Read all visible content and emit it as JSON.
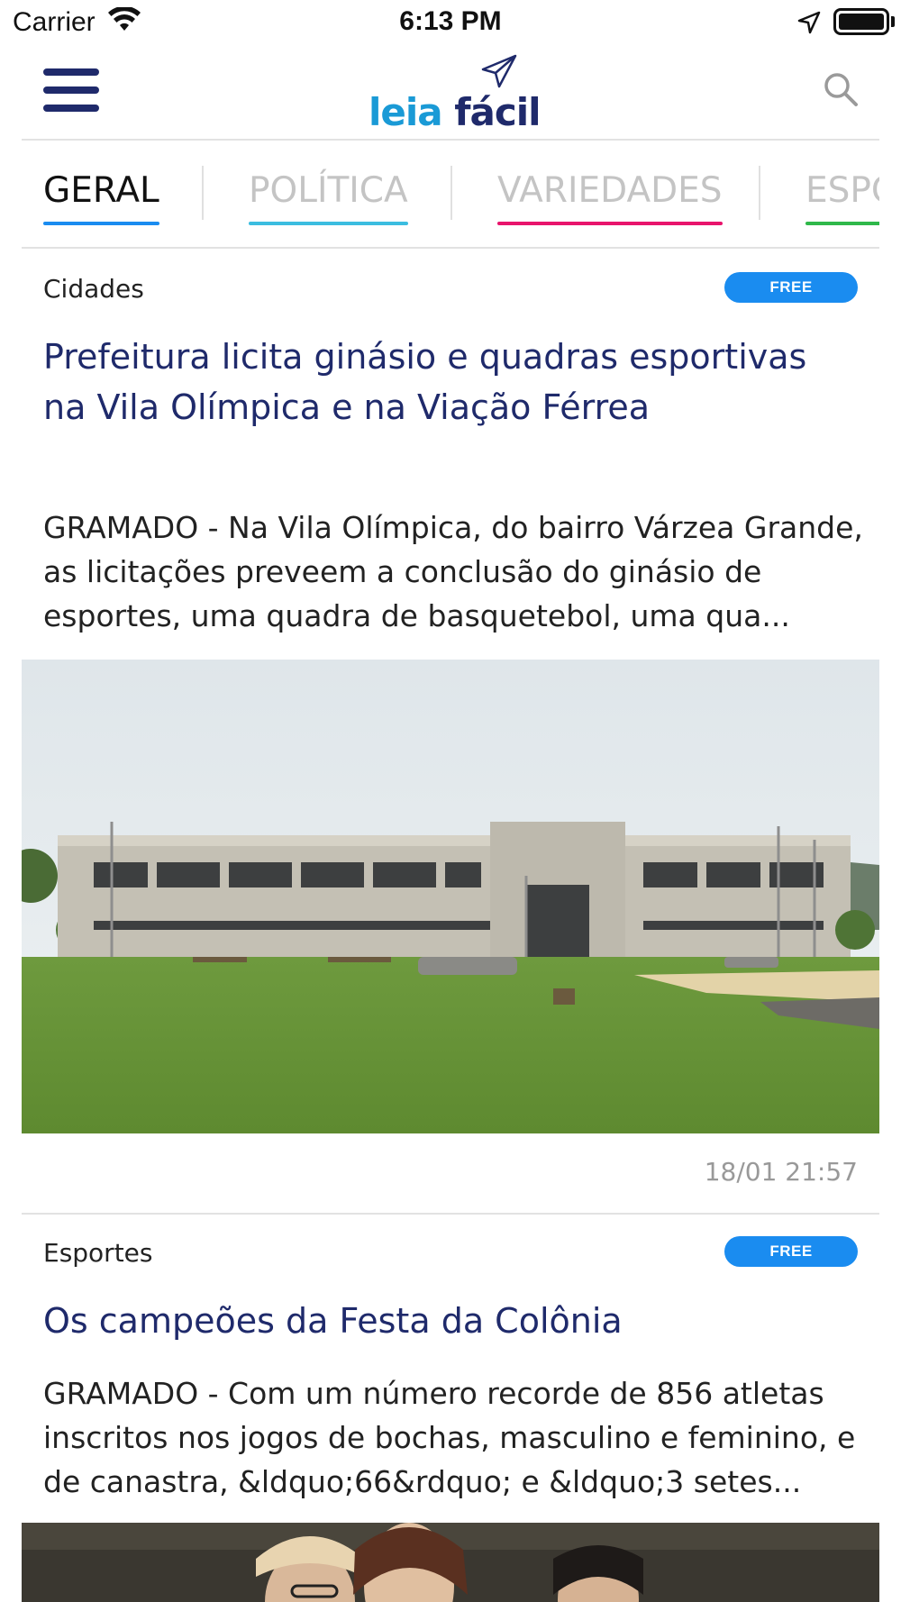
{
  "status_bar": {
    "carrier": "Carrier",
    "time": "6:13 PM"
  },
  "header": {
    "logo_leia": "leia",
    "logo_facil": "fácil"
  },
  "tabs": [
    {
      "label": "GERAL",
      "color": "#1a8cf0",
      "active": true
    },
    {
      "label": "POLÍTICA",
      "color": "#3bbde0",
      "active": false
    },
    {
      "label": "VARIEDADES",
      "color": "#e8146c",
      "active": false
    },
    {
      "label": "ESPORTES",
      "color": "#2fb84a",
      "active": false
    }
  ],
  "articles": [
    {
      "section": "Cidades",
      "badge": "FREE",
      "title": "Prefeitura licita ginásio e quadras esportivas na Vila Olímpica e na Viação Férrea",
      "summary": "GRAMADO - Na Vila Olímpica, do bairro Várzea Grande, as licitações preveem a conclusão do ginásio de esportes, uma quadra de basquetebol, uma qua...",
      "timestamp": "18/01 21:57"
    },
    {
      "section": "Esportes",
      "badge": "FREE",
      "title": "Os campeões da Festa da Colônia",
      "summary": "GRAMADO - Com um número recorde de 856 atletas inscritos nos jogos de bochas, masculino e feminino, e de canastra, &ldquo;66&rdquo; e &ldquo;3 setes..."
    }
  ],
  "colors": {
    "brand_navy": "#1f2a6b",
    "brand_blue": "#1a9ad6",
    "badge_blue": "#1a8cf0"
  }
}
